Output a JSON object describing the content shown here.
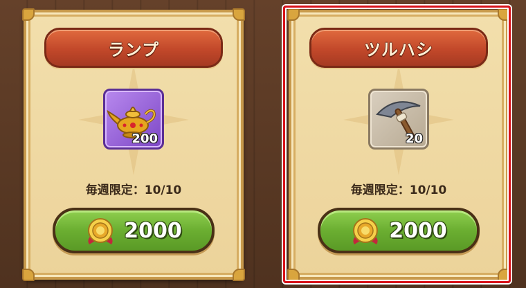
{
  "shop": {
    "items": [
      {
        "name": "ランプ",
        "icon": "golden-lamp-icon",
        "frame_color": "#8f5bd6",
        "quantity": "200",
        "limit_label": "毎週限定：",
        "limit_value": "10/10",
        "price": "2000",
        "currency_icon": "gold-medal-coin-icon"
      },
      {
        "name": "ツルハシ",
        "icon": "pickaxe-icon",
        "frame_color": "#c9bca6",
        "quantity": "20",
        "limit_label": "毎週限定：",
        "limit_value": "10/10",
        "price": "2000",
        "currency_icon": "gold-medal-coin-icon"
      }
    ],
    "selected_index": 1,
    "highlight_color": "#d8121a"
  }
}
